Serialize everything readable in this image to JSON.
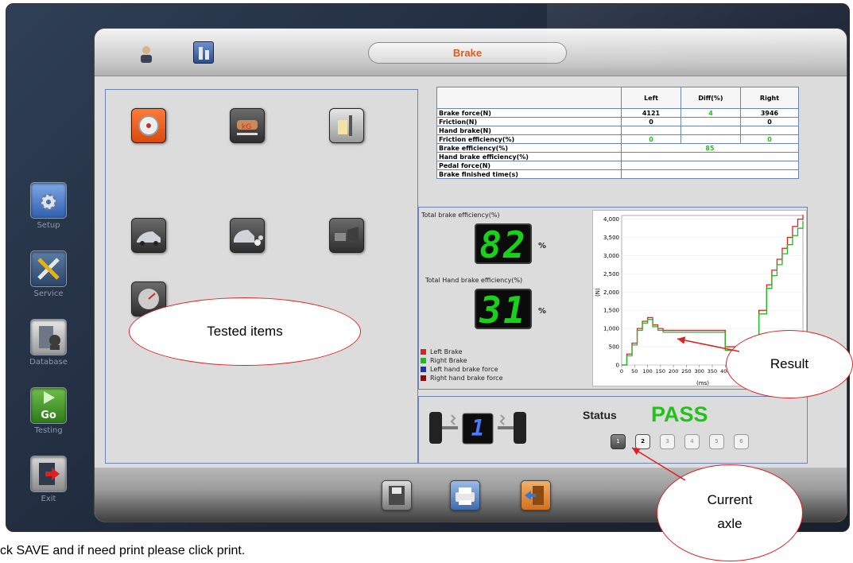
{
  "header": {
    "title": "Brake"
  },
  "nav": [
    {
      "label": "Setup",
      "icon": "gear-folder-icon"
    },
    {
      "label": "Service",
      "icon": "tools-icon"
    },
    {
      "label": "Database",
      "icon": "database-icon"
    },
    {
      "label": "Testing",
      "icon": "go-icon",
      "go_text": "Go"
    },
    {
      "label": "Exit",
      "icon": "exit-icon"
    }
  ],
  "results_table": {
    "columns": [
      "Left",
      "Diff(%)",
      "Right"
    ],
    "rows": [
      {
        "label": "Brake force(N)",
        "left": "4121",
        "diff": "4",
        "right": "3946"
      },
      {
        "label": "Friction(N)",
        "left": "0",
        "diff": "",
        "right": "0"
      },
      {
        "label": "Hand brake(N)",
        "left": "",
        "diff": "",
        "right": ""
      },
      {
        "label": "Friction efficiency(%)",
        "left": "0",
        "diff": "",
        "right": "0"
      },
      {
        "label": "Brake efficiency(%)",
        "value": "85"
      },
      {
        "label": "Hand brake efficiency(%)",
        "value": ""
      },
      {
        "label": "Pedal force(N)",
        "value": ""
      },
      {
        "label": "Brake finished time(s)",
        "value": ""
      }
    ]
  },
  "efficiency": {
    "total_label": "Total brake efficiency(%)",
    "total_value": "82",
    "hand_label": "Total Hand brake efficiency(%)",
    "hand_value": "31",
    "unit": "%"
  },
  "legend": [
    {
      "label": "Left Brake",
      "color": "#e02020"
    },
    {
      "label": "Right Brake",
      "color": "#21b821"
    },
    {
      "label": "Left hand brake force",
      "color": "#1f2fb8"
    },
    {
      "label": "Right hand brake force",
      "color": "#8b0a0a"
    }
  ],
  "chart_data": {
    "type": "line",
    "ylabel": "(N)",
    "xlabel": "(ms)",
    "y_ticks": [
      "4,000",
      "3,500",
      "3,000",
      "2,500",
      "2,000",
      "1,500",
      "1,000",
      "500",
      "0"
    ],
    "x_ticks": [
      "0",
      "50",
      "100",
      "150",
      "200",
      "250",
      "300",
      "350",
      "400",
      "450"
    ],
    "xlim": [
      0,
      700
    ],
    "ylim": [
      0,
      4100
    ],
    "series": [
      {
        "name": "Left Brake",
        "color": "#e02020",
        "x": [
          0,
          20,
          40,
          60,
          80,
          100,
          120,
          140,
          160,
          200,
          250,
          300,
          350,
          380,
          400,
          420,
          440,
          460,
          500,
          530,
          560,
          580,
          600,
          620,
          640,
          660,
          680,
          700
        ],
        "y": [
          0,
          300,
          600,
          1000,
          1200,
          1300,
          1100,
          1000,
          950,
          950,
          950,
          950,
          950,
          950,
          500,
          500,
          500,
          500,
          700,
          1500,
          2200,
          2600,
          2900,
          3200,
          3500,
          3800,
          4000,
          4121
        ]
      },
      {
        "name": "Right Brake",
        "color": "#21b821",
        "x": [
          0,
          20,
          40,
          60,
          80,
          100,
          120,
          140,
          160,
          200,
          250,
          300,
          350,
          380,
          400,
          420,
          440,
          460,
          500,
          530,
          560,
          580,
          600,
          620,
          640,
          660,
          680,
          700
        ],
        "y": [
          0,
          250,
          550,
          950,
          1150,
          1250,
          1050,
          950,
          900,
          900,
          900,
          900,
          900,
          900,
          400,
          400,
          400,
          400,
          600,
          1400,
          2100,
          2450,
          2750,
          3050,
          3300,
          3550,
          3750,
          3946
        ]
      }
    ]
  },
  "status": {
    "label": "Status",
    "value": "PASS",
    "axle_digit": "1"
  },
  "axles": [
    {
      "label": "1",
      "state": "done"
    },
    {
      "label": "2",
      "state": "current"
    },
    {
      "label": "3",
      "state": "idle"
    },
    {
      "label": "4",
      "state": "idle"
    },
    {
      "label": "5",
      "state": "idle"
    },
    {
      "label": "6",
      "state": "idle"
    }
  ],
  "callouts": {
    "tested_items": "Tested items",
    "result": "Result",
    "current_axle_line1": "Current",
    "current_axle_line2": "axle"
  },
  "caption": "ck SAVE and if need print please click print.",
  "colors": {
    "accent": "#e05a1e",
    "pass": "#21c21a",
    "panel_border": "#6b84b8"
  }
}
